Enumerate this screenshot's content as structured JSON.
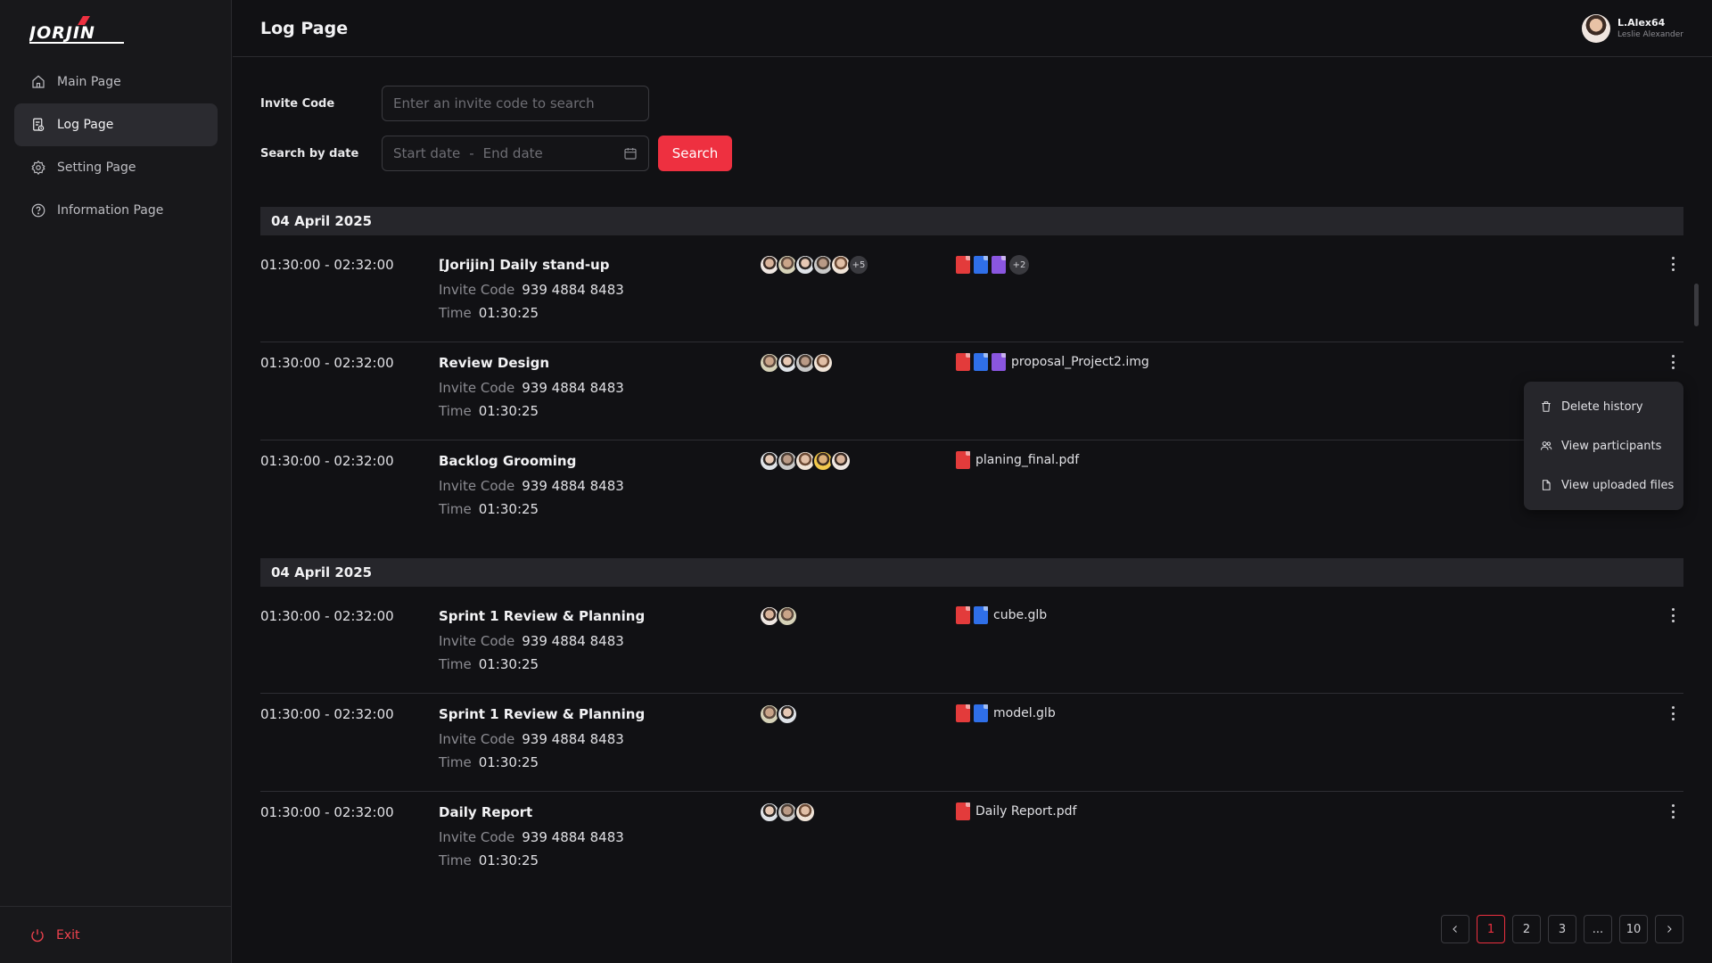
{
  "brand": {
    "logo_text": "JORJIN"
  },
  "sidebar": {
    "items": [
      {
        "label": "Main Page",
        "icon": "home-icon"
      },
      {
        "label": "Log Page",
        "icon": "log-icon"
      },
      {
        "label": "Setting Page",
        "icon": "gear-icon"
      },
      {
        "label": "Information Page",
        "icon": "help-icon"
      }
    ],
    "exit_label": "Exit"
  },
  "header": {
    "title": "Log Page"
  },
  "user": {
    "username": "L.Alex64",
    "full_name": "Leslie Alexander"
  },
  "filters": {
    "invite_label": "Invite Code",
    "invite_placeholder": "Enter an invite code to search",
    "date_label": "Search by date",
    "start_placeholder": "Start date",
    "separator": "-",
    "end_placeholder": "End date",
    "search_label": "Search"
  },
  "labels": {
    "invite_code": "Invite Code",
    "time": "Time"
  },
  "groups": [
    {
      "date": "04 April 2025",
      "rows": [
        {
          "time_range": "01:30:00 - 02:32:00",
          "title": "[Jorijin] Daily stand-up",
          "invite_code": "939 4884 8483",
          "duration": "01:30:25",
          "participants": 5,
          "participants_more": "+5",
          "files": [
            "pdf",
            "doc",
            "img"
          ],
          "files_more": "+2",
          "file_name": ""
        },
        {
          "time_range": "01:30:00 - 02:32:00",
          "title": "Review Design",
          "invite_code": "939 4884 8483",
          "duration": "01:30:25",
          "participants": 4,
          "participants_more": "",
          "files": [
            "pdf",
            "doc",
            "img"
          ],
          "files_more": "",
          "file_name": "proposal_Project2.img"
        },
        {
          "time_range": "01:30:00 - 02:32:00",
          "title": "Backlog Grooming",
          "invite_code": "939 4884 8483",
          "duration": "01:30:25",
          "participants": 5,
          "participants_more": "",
          "files": [
            "pdf"
          ],
          "files_more": "",
          "file_name": "planing_final.pdf"
        }
      ]
    },
    {
      "date": "04 April 2025",
      "rows": [
        {
          "time_range": "01:30:00 - 02:32:00",
          "title": "Sprint 1 Review & Planning",
          "invite_code": "939 4884 8483",
          "duration": "01:30:25",
          "participants": 2,
          "participants_more": "",
          "files": [
            "pdf",
            "doc"
          ],
          "files_more": "",
          "file_name": "cube.glb"
        },
        {
          "time_range": "01:30:00 - 02:32:00",
          "title": "Sprint 1 Review & Planning",
          "invite_code": "939 4884 8483",
          "duration": "01:30:25",
          "participants": 2,
          "participants_more": "",
          "files": [
            "pdf",
            "doc"
          ],
          "files_more": "",
          "file_name": "model.glb"
        },
        {
          "time_range": "01:30:00 - 02:32:00",
          "title": "Daily Report",
          "invite_code": "939 4884 8483",
          "duration": "01:30:25",
          "participants": 3,
          "participants_more": "",
          "files": [
            "pdf"
          ],
          "files_more": "",
          "file_name": "Daily Report.pdf"
        }
      ]
    }
  ],
  "context_menu": {
    "items": [
      {
        "label": "Delete history",
        "icon": "trash-icon"
      },
      {
        "label": "View participants",
        "icon": "users-icon"
      },
      {
        "label": "View uploaded files",
        "icon": "file-icon"
      }
    ]
  },
  "pagination": {
    "pages": [
      "1",
      "2",
      "3",
      "...",
      "10"
    ],
    "current": "1"
  },
  "colors": {
    "accent": "#ee3040",
    "pdf": "#e33b3b",
    "doc": "#2f6fe8",
    "img": "#8a56e0"
  }
}
